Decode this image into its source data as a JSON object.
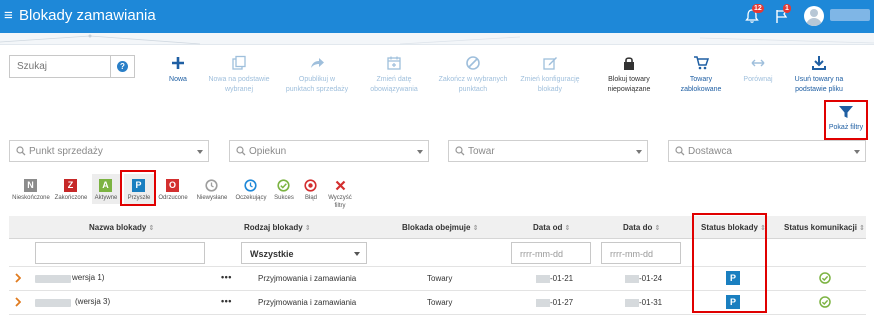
{
  "header": {
    "menu_icon": "hamburger-icon",
    "title": "Blokady zamawiania",
    "notifications_count": "12",
    "messages_count": "1"
  },
  "search": {
    "placeholder": "Szukaj",
    "help_label": "?"
  },
  "toolbar": [
    {
      "label": "Nowa",
      "icon": "plus-icon",
      "state": "active"
    },
    {
      "label": "Nowa na podstawie wybranej",
      "icon": "copy-icon",
      "state": "disabled"
    },
    {
      "label": "Opublikuj w punktach sprzedaży",
      "icon": "share-icon",
      "state": "disabled"
    },
    {
      "label": "Zmień datę obowiązywania",
      "icon": "calendar-icon",
      "state": "disabled"
    },
    {
      "label": "Zakończ w wybranych punktach",
      "icon": "ban-icon",
      "state": "disabled"
    },
    {
      "label": "Zmień konfigurację blokady",
      "icon": "edit-icon",
      "state": "disabled"
    },
    {
      "label": "Blokuj towary niepowiązane",
      "icon": "lock-icon",
      "state": "normal"
    },
    {
      "label": "Towary zablokowane",
      "icon": "cart-icon",
      "state": "active"
    },
    {
      "label": "Porównaj",
      "icon": "compare-icon",
      "state": "disabled"
    },
    {
      "label": "Usuń towary na podstawie pliku",
      "icon": "download-icon",
      "state": "active"
    }
  ],
  "show_filters": {
    "label": "Pokaż filtry",
    "icon": "filter-icon"
  },
  "filters": [
    {
      "placeholder": "Punkt sprzedaży"
    },
    {
      "placeholder": "Opiekun"
    },
    {
      "placeholder": "Towar"
    },
    {
      "placeholder": "Dostawca"
    }
  ],
  "status_filters": [
    {
      "letter": "N",
      "label": "Nieskończone",
      "color": "#8c8c8c"
    },
    {
      "letter": "Z",
      "label": "Zakończone",
      "color": "#c62828"
    },
    {
      "letter": "A",
      "label": "Aktywne",
      "color": "#7cb342"
    },
    {
      "letter": "P",
      "label": "Przyszłe",
      "color": "#1a7fc0"
    },
    {
      "letter": "O",
      "label": "Odrzucone",
      "color": "#d32f2f"
    }
  ],
  "comm_filters": [
    {
      "label": "Niewysłane",
      "color": "#9e9e9e",
      "icon": "clock-gray-icon"
    },
    {
      "label": "Oczekujący",
      "color": "#1e88d8",
      "icon": "clock-blue-icon"
    },
    {
      "label": "Sukces",
      "color": "#7cb342",
      "icon": "check-circle-icon"
    },
    {
      "label": "Błąd",
      "color": "#d32f2f",
      "icon": "error-circle-icon"
    },
    {
      "label": "Wyczyść filtry",
      "color": "#d32f2f",
      "icon": "clear-x-icon"
    }
  ],
  "table": {
    "columns": [
      "Nazwa blokady",
      "Rodzaj blokady",
      "Blokada obejmuje",
      "Data od",
      "Data do",
      "Status blokady",
      "Status komunikacji"
    ],
    "filter_row": {
      "rodzaj_value": "Wszystkie",
      "date_from_placeholder": "rrrr-mm-dd",
      "date_to_placeholder": "rrrr-mm-dd"
    },
    "rows": [
      {
        "name_suffix": "wersja 1)",
        "rodzaj": "Przyjmowania i zamawiania",
        "obejmuje": "Towary",
        "date_from": "-01-21",
        "date_to": "-01-24",
        "status": "P",
        "actions": "•••"
      },
      {
        "name_suffix": "(wersja 3)",
        "rodzaj": "Przyjmowania i zamawiania",
        "obejmuje": "Towary",
        "date_from": "-01-27",
        "date_to": "-01-31",
        "status": "P",
        "actions": "•••"
      }
    ]
  },
  "colors": {
    "brand": "#1e88d8",
    "highlight": "#e00000",
    "status_p": "#1a7fc0",
    "success": "#7cb342"
  }
}
